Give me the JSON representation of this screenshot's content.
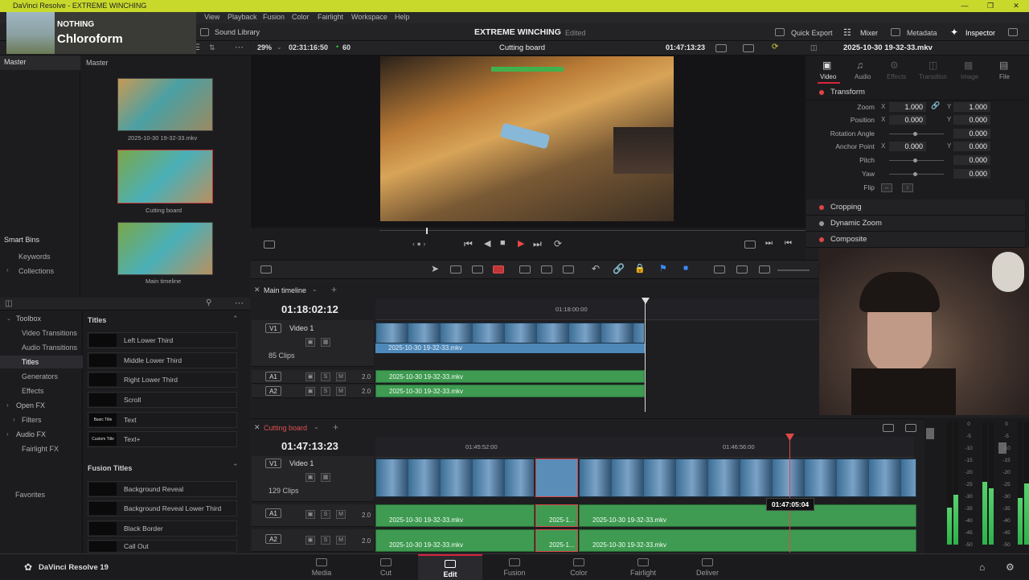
{
  "window": {
    "title": "DaVinci Resolve - EXTREME WINCHING"
  },
  "nowplaying": {
    "artist": "NOTHING",
    "track": "Chloroform"
  },
  "menu": [
    "View",
    "Playback",
    "Fusion",
    "Color",
    "Fairlight",
    "Workspace",
    "Help"
  ],
  "toolbar": {
    "sound_library": "Sound Library",
    "project_title": "EXTREME WINCHING",
    "project_status": "Edited",
    "quick_export": "Quick Export",
    "mixer": "Mixer",
    "metadata": "Metadata",
    "inspector": "Inspector"
  },
  "mediapool": {
    "left_header": "Master",
    "right_header": "Master",
    "clips": [
      "2025-10-30 19-32-33.mkv",
      "Cutting board",
      "Main timeline"
    ],
    "smart_bins": "Smart Bins",
    "keywords": "Keywords",
    "collections": "Collections"
  },
  "viewer": {
    "zoom": "29%",
    "source_tc": "02:31:16:50",
    "fps": "60",
    "name": "Cutting board",
    "record_tc": "01:47:13:23"
  },
  "effects": {
    "toolbox": "Toolbox",
    "items": [
      "Video Transitions",
      "Audio Transitions",
      "Titles",
      "Generators",
      "Effects",
      "Open FX",
      "Filters",
      "Audio FX",
      "Fairlight FX"
    ],
    "favorites": "Favorites",
    "titles_header": "Titles",
    "titles": [
      {
        "name": "Left Lower Third",
        "thumb": ""
      },
      {
        "name": "Middle Lower Third",
        "thumb": ""
      },
      {
        "name": "Right Lower Third",
        "thumb": ""
      },
      {
        "name": "Scroll",
        "thumb": ""
      },
      {
        "name": "Text",
        "thumb": "Basic Title"
      },
      {
        "name": "Text+",
        "thumb": "Custom Title"
      }
    ],
    "fusion_header": "Fusion Titles",
    "fusion_titles": [
      {
        "name": "Background Reveal",
        "thumb": ""
      },
      {
        "name": "Background Reveal Lower Third",
        "thumb": ""
      },
      {
        "name": "Black Border",
        "thumb": ""
      },
      {
        "name": "Call Out",
        "thumb": ""
      }
    ]
  },
  "timeline1": {
    "tab": "Main timeline",
    "tc": "01:18:02:12",
    "ruler": [
      "01:18:00:00"
    ],
    "v1": "V1",
    "video1": "Video 1",
    "clips": "85 Clips",
    "a1": "A1",
    "a2": "A2",
    "level": "2.0",
    "clip": "2025-10-30 19-32-33.mkv"
  },
  "timeline2": {
    "tab": "Cutting board",
    "tc": "01:47:13:23",
    "ruler": [
      "01:45:52:00",
      "01:46:56:00"
    ],
    "v1": "V1",
    "video1": "Video 1",
    "clips": "129 Clips",
    "a1": "A1",
    "a2": "A2",
    "level": "2.0",
    "clip": "2025-10-30 19-32-33.mkv",
    "clip_short": "2025-1...",
    "tooltip": "01:47:05:04"
  },
  "inspector": {
    "file": "2025-10-30 19-32-33.mkv",
    "tabs": [
      "Video",
      "Audio",
      "Effects",
      "Transition",
      "Image",
      "File"
    ],
    "transform": "Transform",
    "zoom_label": "Zoom",
    "zoom_x": "1.000",
    "zoom_y": "1.000",
    "position_label": "Position",
    "pos_x": "0.000",
    "pos_y": "0.000",
    "rotation_label": "Rotation Angle",
    "rotation": "0.000",
    "anchor_label": "Anchor Point",
    "anchor_x": "0.000",
    "anchor_y": "0.000",
    "pitch_label": "Pitch",
    "pitch": "0.000",
    "yaw_label": "Yaw",
    "yaw": "0.000",
    "flip_label": "Flip",
    "x": "X",
    "y": "Y",
    "cropping": "Cropping",
    "dynamic_zoom": "Dynamic Zoom",
    "composite": "Composite"
  },
  "meter_scale": [
    "0",
    "-5",
    "-10",
    "-15",
    "-20",
    "-25",
    "-30",
    "-35",
    "-40",
    "-45",
    "-50"
  ],
  "pages": [
    "Media",
    "Cut",
    "Edit",
    "Fusion",
    "Color",
    "Fairlight",
    "Deliver"
  ],
  "app_name": "DaVinci Resolve 19",
  "colors": {
    "accent_red": "#d6243e",
    "video_clip": "#4d88b8",
    "audio_clip": "#3f9a52",
    "titlebar": "#c8d92c"
  }
}
